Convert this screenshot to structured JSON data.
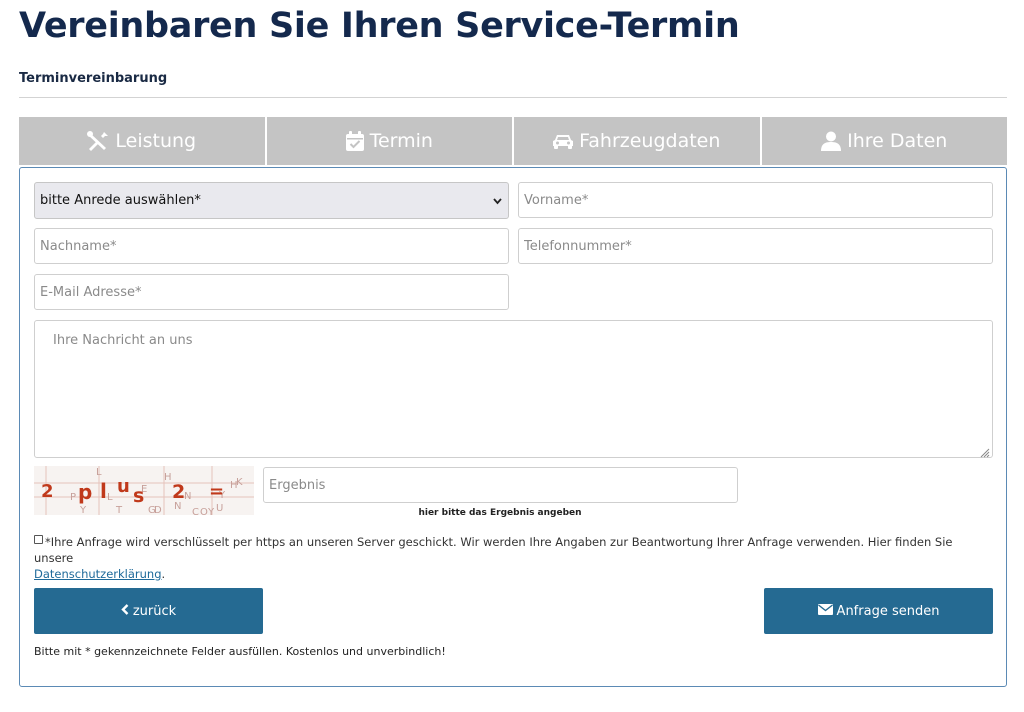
{
  "page": {
    "title": "Vereinbaren Sie Ihren Service-Termin",
    "section_label": "Terminvereinbarung"
  },
  "tabs": [
    {
      "label": "Leistung",
      "icon": "tools-icon"
    },
    {
      "label": "Termin",
      "icon": "calendar-check-icon"
    },
    {
      "label": "Fahrzeugdaten",
      "icon": "car-icon"
    },
    {
      "label": "Ihre Daten",
      "icon": "user-icon"
    }
  ],
  "form": {
    "salutation_select": {
      "value": "bitte Anrede auswählen*"
    },
    "first_name": {
      "placeholder": "Vorname*",
      "value": ""
    },
    "last_name": {
      "placeholder": "Nachname*",
      "value": ""
    },
    "phone": {
      "placeholder": "Telefonnummer*",
      "value": ""
    },
    "email": {
      "placeholder": "E-Mail Adresse*",
      "value": ""
    },
    "message": {
      "placeholder": "Ihre Nachricht an uns",
      "value": ""
    },
    "captcha": {
      "challenge": [
        "2",
        "p",
        "l",
        "u",
        "s",
        "2",
        "="
      ],
      "result_placeholder": "Ergebnis",
      "hint": "hier bitte das Ergebnis angeben"
    },
    "consent": {
      "text": "*Ihre Anfrage wird verschlüsselt per https an unseren Server geschickt. Wir werden Ihre Angaben zur Beantwortung Ihrer Anfrage verwenden. Hier finden Sie unsere",
      "link": "Datenschutzerklärung",
      "suffix": "."
    },
    "back_button": {
      "label": "zurück",
      "icon": "chevron-left-icon"
    },
    "submit_button": {
      "label": "Anfrage senden",
      "icon": "envelope-icon"
    },
    "footnote": "Bitte mit * gekennzeichnete Felder ausfüllen. Kostenlos und unverbindlich!"
  },
  "colors": {
    "title": "#14294d",
    "tab_inactive": "#c4c4c4",
    "button": "#256a92",
    "form_border": "#5b8ab5",
    "captcha_text": "#c0391b"
  }
}
